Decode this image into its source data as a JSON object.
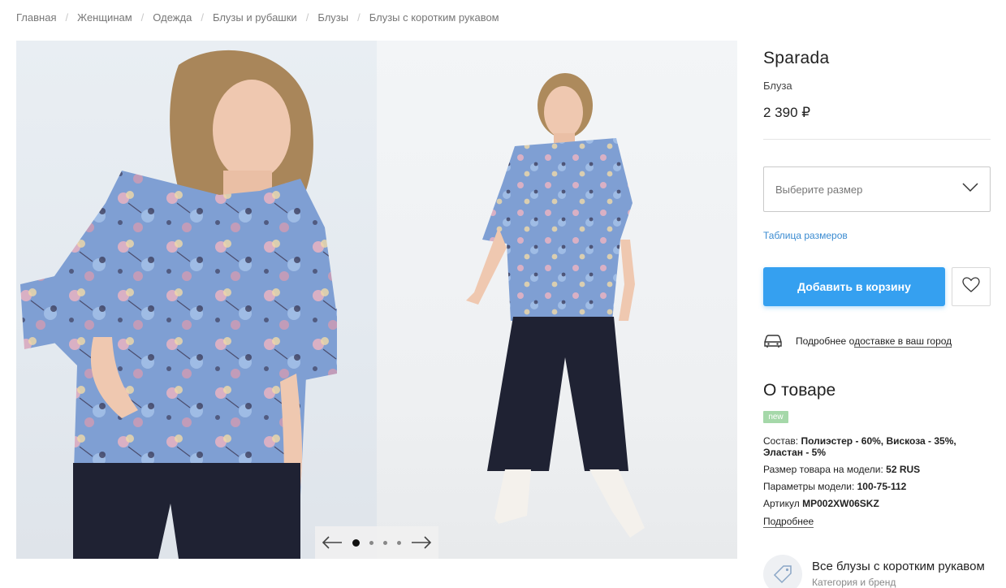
{
  "breadcrumb": [
    {
      "label": "Главная"
    },
    {
      "label": "Женщинам"
    },
    {
      "label": "Одежда"
    },
    {
      "label": "Блузы и рубашки"
    },
    {
      "label": "Блузы"
    },
    {
      "label": "Блузы с коротким рукавом"
    }
  ],
  "product": {
    "brand": "Sparada",
    "type": "Блуза",
    "price": "2 390 ₽"
  },
  "size_select": {
    "placeholder": "Выберите размер",
    "icon": "chevron-down-icon"
  },
  "size_table_link": "Таблица размеров",
  "add_to_cart_label": "Добавить в корзину",
  "favorite_icon": "heart-icon",
  "delivery": {
    "prefix": "Подробнее о ",
    "link": "доставке в ваш город",
    "icon": "car-icon"
  },
  "about": {
    "title": "О товаре",
    "badge": "new",
    "composition_label": "Состав:",
    "composition_value": "Полиэстер - 60%, Вискоза - 35%, Эластан - 5%",
    "model_size_label": "Размер товара на модели:",
    "model_size_value": "52 RUS",
    "model_params_label": "Параметры модели:",
    "model_params_value": "100-75-112",
    "sku_label": "Артикул",
    "sku_value": "MP002XW06SKZ",
    "more_link": "Подробнее"
  },
  "category": {
    "title": "Все блузы с коротким рукавом",
    "subtitle": "Категория и бренд",
    "icon": "tag-icon"
  },
  "gallery": {
    "slide_count": 4,
    "active_slide": 1
  },
  "colors": {
    "accent": "#35a0f0",
    "link": "#3a8bd1",
    "badge": "#a5d8a9",
    "blouse": "#7b9bd0",
    "trousers": "#1f2233"
  }
}
